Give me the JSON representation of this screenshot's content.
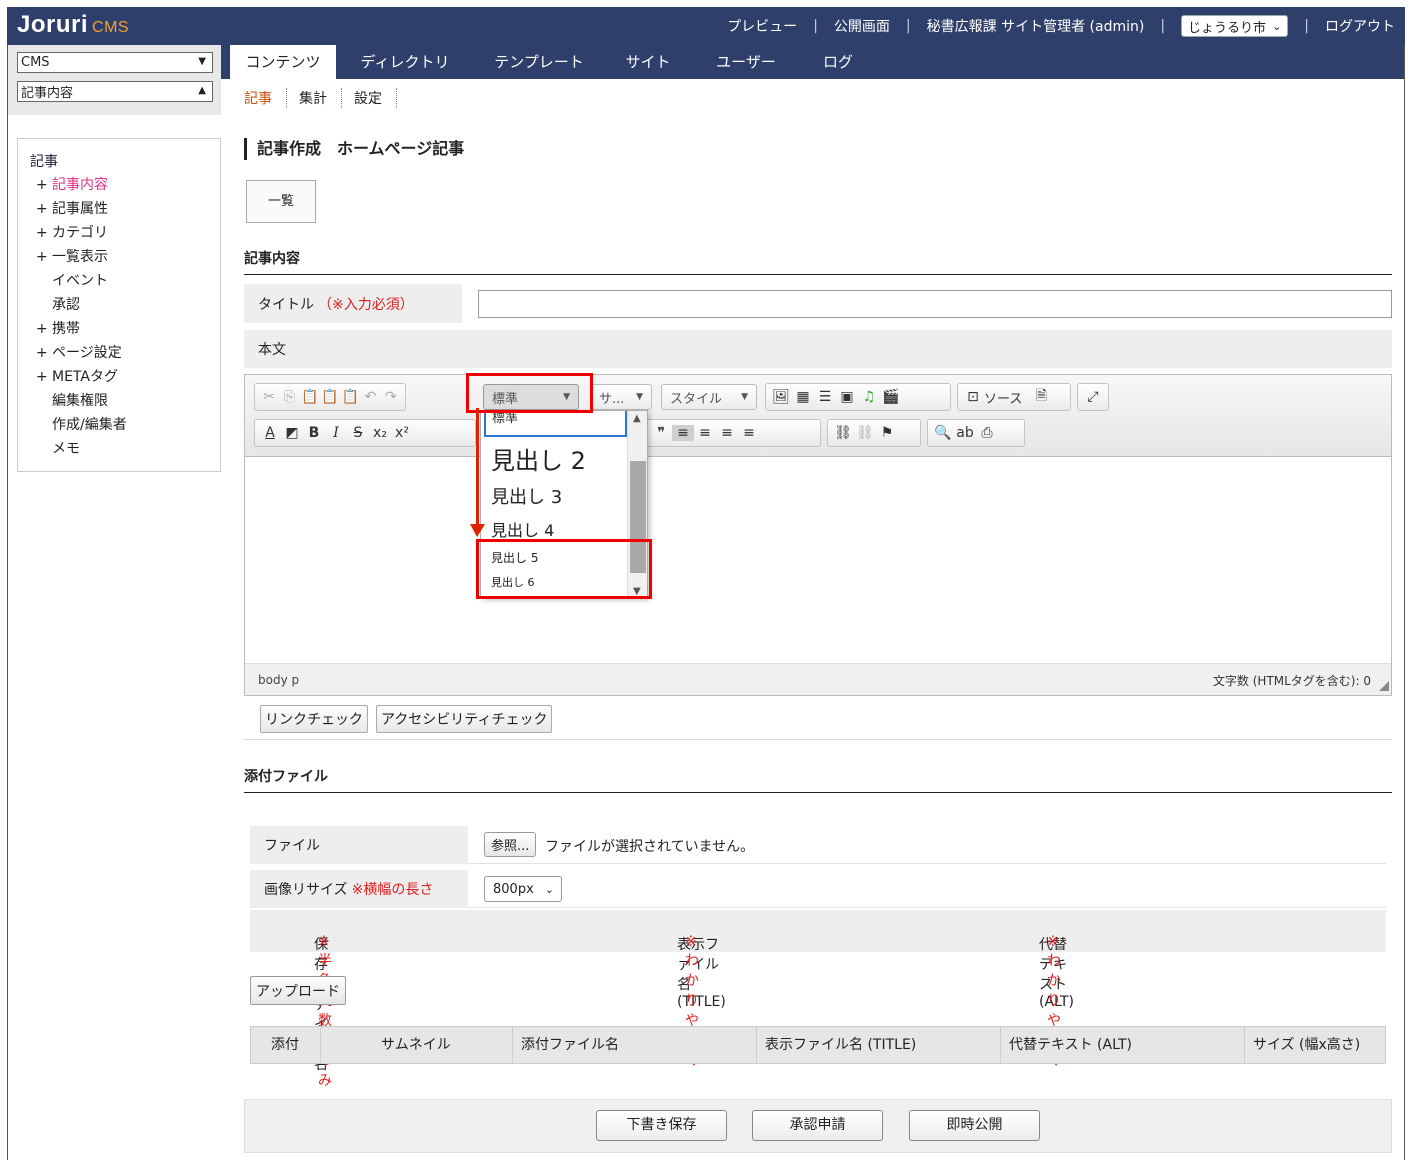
{
  "header": {
    "logo_main": "Joruri",
    "logo_sub": "CMS",
    "links": {
      "preview": "プレビュー",
      "public": "公開画面",
      "user": "秘書広報課 サイト管理者 (admin)",
      "city": "じょうるり市",
      "logout": "ログアウト"
    },
    "separator": "|"
  },
  "left_top": {
    "select1": "CMS",
    "select2": "記事内容"
  },
  "tabs": [
    "コンテンツ",
    "ディレクトリ",
    "テンプレート",
    "サイト",
    "ユーザー",
    "ログ"
  ],
  "subtabs": [
    "記事",
    "集計",
    "設定"
  ],
  "sidebar": {
    "title": "記事",
    "items": [
      {
        "label": "記事内容",
        "plus": "+"
      },
      {
        "label": "記事属性",
        "plus": "+"
      },
      {
        "label": "カテゴリ",
        "plus": "+"
      },
      {
        "label": "一覧表示",
        "plus": "+"
      },
      {
        "label": "イベント",
        "plus": ""
      },
      {
        "label": "承認",
        "plus": ""
      },
      {
        "label": "携帯",
        "plus": "+"
      },
      {
        "label": "ページ設定",
        "plus": "+"
      },
      {
        "label": "METAタグ",
        "plus": "+"
      },
      {
        "label": "編集権限",
        "plus": ""
      },
      {
        "label": "作成/編集者",
        "plus": ""
      },
      {
        "label": "メモ",
        "plus": ""
      }
    ]
  },
  "main": {
    "page_title": "記事作成　ホームページ記事",
    "list_button": "一覧",
    "section_content": "記事内容",
    "title_label": "タイトル",
    "title_required": "（※入力必須）",
    "body_label": "本文"
  },
  "editor": {
    "format_combo": "標準",
    "size_combo": "サ...",
    "style_combo": "スタイル",
    "source_label": "ソース",
    "format_options": [
      "標準",
      "見出し 2",
      "見出し 3",
      "見出し 4",
      "見出し 5",
      "見出し 6"
    ],
    "path": "body  p",
    "word_count": "文字数 (HTMLタグを含む): 0"
  },
  "checks": {
    "link_check": "リンクチェック",
    "a11y_check": "アクセシビリティチェック"
  },
  "attachments": {
    "section_title": "添付ファイル",
    "file_label": "ファイル",
    "browse_button": "参照...",
    "no_file": "ファイルが選択されていません。",
    "resize_label": "画像リサイズ",
    "resize_note": "※横幅の長さ",
    "resize_value": "800px",
    "save_name_label": "保存ファイル名",
    "save_name_note": "※半角英数字のみ",
    "display_name_label": "表示ファイル名 (TITLE)",
    "display_name_note": "※わかりやすく",
    "alt_label": "代替テキスト (ALT)",
    "alt_note": "※わかりやすく",
    "upload_button": "アップロード",
    "table_headers": [
      "添付",
      "サムネイル",
      "添付ファイル名",
      "表示ファイル名 (TITLE)",
      "代替テキスト (ALT)",
      "サイズ (幅x高さ)"
    ]
  },
  "footer": {
    "draft": "下書き保存",
    "approval": "承認申請",
    "publish": "即時公開"
  },
  "colors": {
    "header_bg": "#2f3f6b",
    "highlight": "#e00000",
    "required": "#e02020",
    "active_sidebar": "#e0308a",
    "active_subtab": "#c8500a"
  }
}
